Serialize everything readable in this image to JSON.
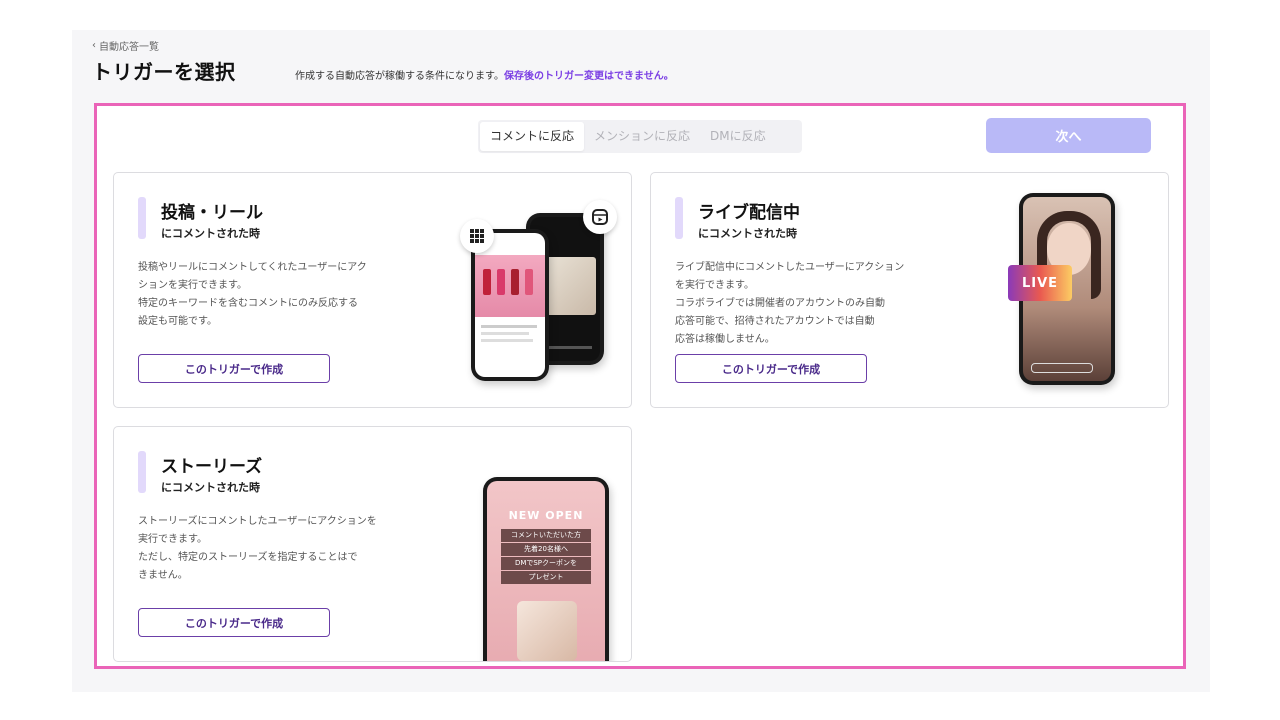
{
  "breadcrumb": {
    "back_label": "自動応答一覧"
  },
  "header": {
    "title": "トリガーを選択",
    "subtitle": "作成する自動応答が稼働する条件になります。",
    "subtitle_note": "保存後のトリガー変更はできません。"
  },
  "tabs": [
    {
      "label": "コメントに反応",
      "active": true
    },
    {
      "label": "メンションに反応",
      "active": false
    },
    {
      "label": "DMに反応",
      "active": false
    }
  ],
  "next_label": "次へ",
  "cards": {
    "post": {
      "title": "投稿・リール",
      "subtitle": "にコメントされた時",
      "desc": [
        "投稿やリールにコメントしてくれたユーザーにアク",
        "ションを実行できます。",
        "特定のキーワードを含むコメントにのみ反応する",
        "設定も可能です。"
      ],
      "button": "このトリガーで作成"
    },
    "live": {
      "title": "ライブ配信中",
      "subtitle": "にコメントされた時",
      "desc": [
        "ライブ配信中にコメントしたユーザーにアクション",
        "を実行できます。",
        "コラボライブでは開催者のアカウントのみ自動",
        "応答可能で、招待されたアカウントでは自動",
        "応答は稼働しません。"
      ],
      "button": "このトリガーで作成",
      "badge": "LIVE"
    },
    "story": {
      "title": "ストーリーズ",
      "subtitle": "にコメントされた時",
      "desc": [
        "ストーリーズにコメントしたユーザーにアクションを",
        "実行できます。",
        "ただし、特定のストーリーズを指定することはで",
        "きません。"
      ],
      "button": "このトリガーで作成",
      "story_text": {
        "line1": "NEW OPEN",
        "box": [
          "コメントいただいた方",
          "先着20名様へ",
          "DMでSPクーポンを",
          "プレゼント"
        ]
      }
    }
  },
  "colors": {
    "accent": "#7b3fe4",
    "frame": "#ea64b8",
    "next": "#b9b9f7"
  }
}
